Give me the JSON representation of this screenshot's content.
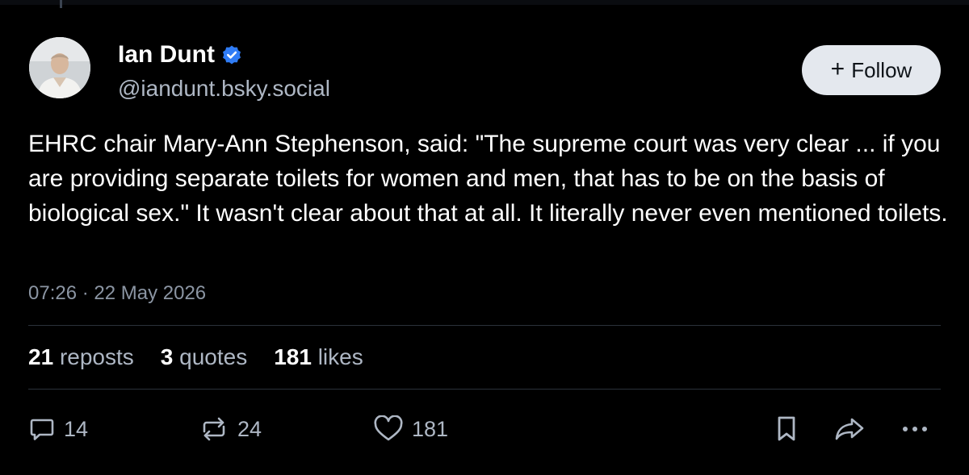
{
  "post": {
    "author": {
      "display_name": "Ian Dunt",
      "handle": "@iandunt.bsky.social",
      "verified": true
    },
    "follow_label": "Follow",
    "text": "EHRC chair Mary-Ann Stephenson, said: \"The supreme court was very clear ... if you are providing separate toilets for women and men, that has to be on the basis of biological sex.\" It wasn't clear about that at all. It literally never even mentioned toilets.",
    "timestamp": "07:26 · 22 May 2026",
    "stats": {
      "reposts_count": "21",
      "reposts_label": "reposts",
      "quotes_count": "3",
      "quotes_label": "quotes",
      "likes_count": "181",
      "likes_label": "likes"
    },
    "actions": {
      "reply_count": "14",
      "repost_count": "24",
      "like_count": "181"
    }
  },
  "colors": {
    "background": "#000000",
    "verified_badge": "#2f7cf6",
    "secondary_text": "#aeb7c4",
    "follow_button_bg": "#e4e8ee"
  },
  "icons": [
    "verified-icon",
    "plus-icon",
    "reply-icon",
    "repost-icon",
    "like-icon",
    "bookmark-icon",
    "share-icon",
    "more-icon"
  ]
}
